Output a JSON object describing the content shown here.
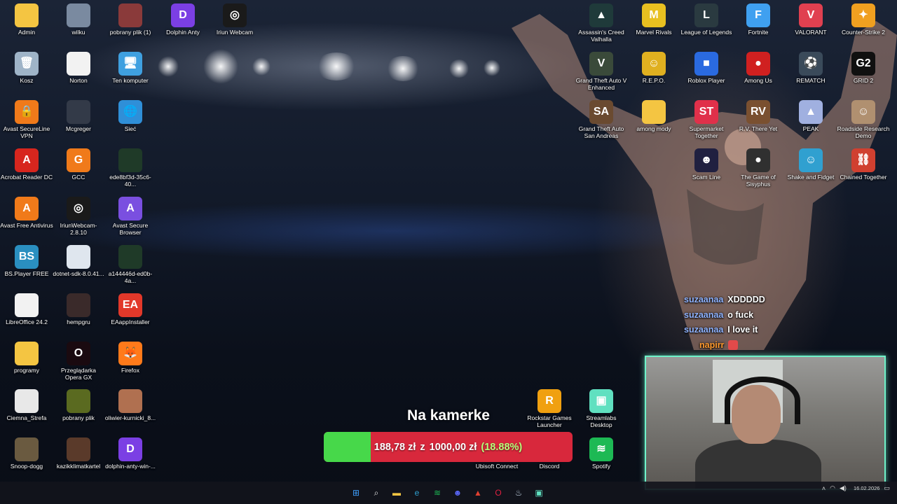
{
  "colors": {
    "goal_fill": "#47d84a",
    "goal_empty": "#d8283c",
    "cam_border": "#6ff2c9"
  },
  "desktop": {
    "icons": [
      {
        "label": "Admin",
        "icon": "folder-icon",
        "color": "#f4c542",
        "glyph": ""
      },
      {
        "label": "wilku",
        "icon": "image-icon",
        "color": "#7a8aa0",
        "glyph": ""
      },
      {
        "label": "pobrany plik (1)",
        "icon": "image-icon",
        "color": "#8a3a3a",
        "glyph": ""
      },
      {
        "label": "Dolphin Anty",
        "icon": "dolphin-anty-icon",
        "color": "#7b3fe4",
        "glyph": "D"
      },
      {
        "label": "Iriun Webcam",
        "icon": "webcam-icon",
        "color": "#1a1a1a",
        "glyph": "◎"
      },
      {
        "label": "Kosz",
        "icon": "recycle-bin-icon",
        "color": "#9fb4c8",
        "glyph": "🗑"
      },
      {
        "label": "Norton",
        "icon": "file-icon",
        "color": "#f2f2f2",
        "glyph": ""
      },
      {
        "label": "Ten komputer",
        "icon": "computer-icon",
        "color": "#3fa0e0",
        "glyph": "🖥"
      },
      {
        "label": "Avast SecureLine VPN",
        "icon": "avast-vpn-icon",
        "color": "#f07a1a",
        "glyph": "🔒"
      },
      {
        "label": "Mcgreger",
        "icon": "image-icon",
        "color": "#333a48",
        "glyph": ""
      },
      {
        "label": "Sieć",
        "icon": "network-icon",
        "color": "#2f8fd8",
        "glyph": "🌐"
      },
      {
        "label": "Acrobat Reader DC",
        "icon": "acrobat-icon",
        "color": "#d7261e",
        "glyph": "A"
      },
      {
        "label": "GCC",
        "icon": "gcc-icon",
        "color": "#f07a1a",
        "glyph": "G"
      },
      {
        "label": "ede8bf3d-35c6-40...",
        "icon": "image-icon",
        "color": "#1f3a28",
        "glyph": ""
      },
      {
        "label": "Avast Free Antivirus",
        "icon": "avast-icon",
        "color": "#f07a1a",
        "glyph": "A"
      },
      {
        "label": "IriunWebcam-2.8.10",
        "icon": "webcam-icon",
        "color": "#1a1a1a",
        "glyph": "◎"
      },
      {
        "label": "Avast Secure Browser",
        "icon": "avast-browser-icon",
        "color": "#7a4fe0",
        "glyph": "A"
      },
      {
        "label": "BS.Player FREE",
        "icon": "bsplayer-icon",
        "color": "#2a8fc0",
        "glyph": "BS"
      },
      {
        "label": "dotnet-sdk-8.0.41...",
        "icon": "installer-icon",
        "color": "#dfe6ee",
        "glyph": ""
      },
      {
        "label": "a144446d-ed0b-4a...",
        "icon": "image-icon",
        "color": "#1f3a28",
        "glyph": ""
      },
      {
        "label": "LibreOffice 24.2",
        "icon": "file-icon",
        "color": "#f2f2f2",
        "glyph": ""
      },
      {
        "label": "hempgru",
        "icon": "image-icon",
        "color": "#3a2a2a",
        "glyph": ""
      },
      {
        "label": "EAappInstaller",
        "icon": "ea-icon",
        "color": "#e2382a",
        "glyph": "EA"
      },
      {
        "label": "programy",
        "icon": "folder-icon",
        "color": "#f4c542",
        "glyph": ""
      },
      {
        "label": "Przeglądarka Opera GX",
        "icon": "opera-gx-icon",
        "color": "#1a0a10",
        "glyph": "O"
      },
      {
        "label": "Firefox",
        "icon": "firefox-icon",
        "color": "#ff7a1a",
        "glyph": "🦊"
      },
      {
        "label": "Ciemna_Strefa",
        "icon": "image-icon",
        "color": "#e8e8e8",
        "glyph": ""
      },
      {
        "label": "pobrany plik",
        "icon": "image-icon",
        "color": "#5a6a20",
        "glyph": ""
      },
      {
        "label": "oliwier-kurnicki_8...",
        "icon": "image-icon",
        "color": "#b07050",
        "glyph": ""
      },
      {
        "label": "Snoop-dogg",
        "icon": "image-icon",
        "color": "#6a5a40",
        "glyph": ""
      },
      {
        "label": "kazikklimatkartel",
        "icon": "image-icon",
        "color": "#5a3a2a",
        "glyph": ""
      },
      {
        "label": "dolphin-anty-win-...",
        "icon": "dolphin-anty-icon",
        "color": "#7b3fe4",
        "glyph": "D"
      },
      {
        "label": "Assassin's Creed Valhalla",
        "icon": "assassins-creed-icon",
        "color": "#1f3a3a",
        "glyph": "▲"
      },
      {
        "label": "Marvel Rivals",
        "icon": "marvel-rivals-icon",
        "color": "#e8c020",
        "glyph": "M"
      },
      {
        "label": "League of Legends",
        "icon": "league-icon",
        "color": "#2a3a40",
        "glyph": "L"
      },
      {
        "label": "Fortnite",
        "icon": "fortnite-icon",
        "color": "#3fa0f0",
        "glyph": "F"
      },
      {
        "label": "VALORANT",
        "icon": "valorant-icon",
        "color": "#e04050",
        "glyph": "V"
      },
      {
        "label": "Counter-Strike 2",
        "icon": "cs2-icon",
        "color": "#f0a020",
        "glyph": "✦"
      },
      {
        "label": "Grand Theft Auto V Enhanced",
        "icon": "gta-v-icon",
        "color": "#3a4a3a",
        "glyph": "V"
      },
      {
        "label": "R.E.P.O.",
        "icon": "repo-icon",
        "color": "#e0b020",
        "glyph": "☺"
      },
      {
        "label": "Roblox Player",
        "icon": "roblox-icon",
        "color": "#2a6ae0",
        "glyph": "■"
      },
      {
        "label": "Among Us",
        "icon": "among-us-icon",
        "color": "#d02020",
        "glyph": "●"
      },
      {
        "label": "REMATCH",
        "icon": "rematch-icon",
        "color": "#3a4a5a",
        "glyph": "⚽"
      },
      {
        "label": "GRID 2",
        "icon": "grid2-icon",
        "color": "#101010",
        "glyph": "G2"
      },
      {
        "label": "Grand Theft Auto San Andreas",
        "icon": "gta-sa-icon",
        "color": "#6a4a30",
        "glyph": "SA"
      },
      {
        "label": "among mody",
        "icon": "folder-icon",
        "color": "#f4c542",
        "glyph": ""
      },
      {
        "label": "Supermarket Together",
        "icon": "supermarket-icon",
        "color": "#e0304a",
        "glyph": "ST"
      },
      {
        "label": "R.V. There Yet",
        "icon": "rv-icon",
        "color": "#7a5030",
        "glyph": "RV"
      },
      {
        "label": "PEAK",
        "icon": "peak-icon",
        "color": "#a0b0e0",
        "glyph": "▲"
      },
      {
        "label": "Roadside Research Demo",
        "icon": "roadside-icon",
        "color": "#b09070",
        "glyph": "☺"
      },
      {
        "label": "Scam Line",
        "icon": "scam-line-icon",
        "color": "#202040",
        "glyph": "☻"
      },
      {
        "label": "The Game of Sisyphus",
        "icon": "sisyphus-icon",
        "color": "#303030",
        "glyph": "●"
      },
      {
        "label": "Shake and Fidget",
        "icon": "shakes-icon",
        "color": "#30a0d0",
        "glyph": "☺"
      },
      {
        "label": "Chained Together",
        "icon": "chained-icon",
        "color": "#d04030",
        "glyph": "⛓"
      },
      {
        "label": "Rockstar Games Launcher",
        "icon": "rockstar-icon",
        "color": "#f0a010",
        "glyph": "R"
      },
      {
        "label": "Streamlabs Desktop",
        "icon": "streamlabs-icon",
        "color": "#60e0c0",
        "glyph": "▣"
      },
      {
        "label": "Ubisoft Connect",
        "icon": "ubisoft-icon",
        "color": "#405080",
        "glyph": "U"
      },
      {
        "label": "Discord",
        "icon": "discord-icon",
        "color": "#5865f2",
        "glyph": "☻"
      },
      {
        "label": "Spotify",
        "icon": "spotify-icon",
        "color": "#1db954",
        "glyph": "≋"
      }
    ]
  },
  "chat": [
    {
      "user": "suzaanaa",
      "message": "XDDDDD"
    },
    {
      "user": "suzaanaa",
      "message": "o fuck"
    },
    {
      "user": "suzaanaa",
      "message": "I love it"
    },
    {
      "user": "napirr",
      "message": ""
    }
  ],
  "goal": {
    "title": "Na kamerke",
    "current": "188,78 zł",
    "separator": "z",
    "target": "1000,00 zł",
    "percent": "(18.88%)",
    "fraction": 0.1888
  },
  "taskbar": {
    "icons": [
      {
        "name": "start-icon",
        "glyph": "⊞",
        "color": "#3fa0ff"
      },
      {
        "name": "search-icon",
        "glyph": "⌕",
        "color": "#e0e0e0"
      },
      {
        "name": "file-explorer-icon",
        "glyph": "▬",
        "color": "#f4c542"
      },
      {
        "name": "edge-icon",
        "glyph": "e",
        "color": "#2fa0d0"
      },
      {
        "name": "spotify-icon",
        "glyph": "≋",
        "color": "#1db954"
      },
      {
        "name": "discord-icon",
        "glyph": "☻",
        "color": "#5865f2"
      },
      {
        "name": "terminal-icon",
        "glyph": "▲",
        "color": "#e04030"
      },
      {
        "name": "opera-gx-icon",
        "glyph": "O",
        "color": "#e02040"
      },
      {
        "name": "steam-icon",
        "glyph": "♨",
        "color": "#c0d0e0"
      },
      {
        "name": "streamlabs-icon",
        "glyph": "▣",
        "color": "#60e0c0"
      }
    ],
    "date": "16.02.2026"
  }
}
